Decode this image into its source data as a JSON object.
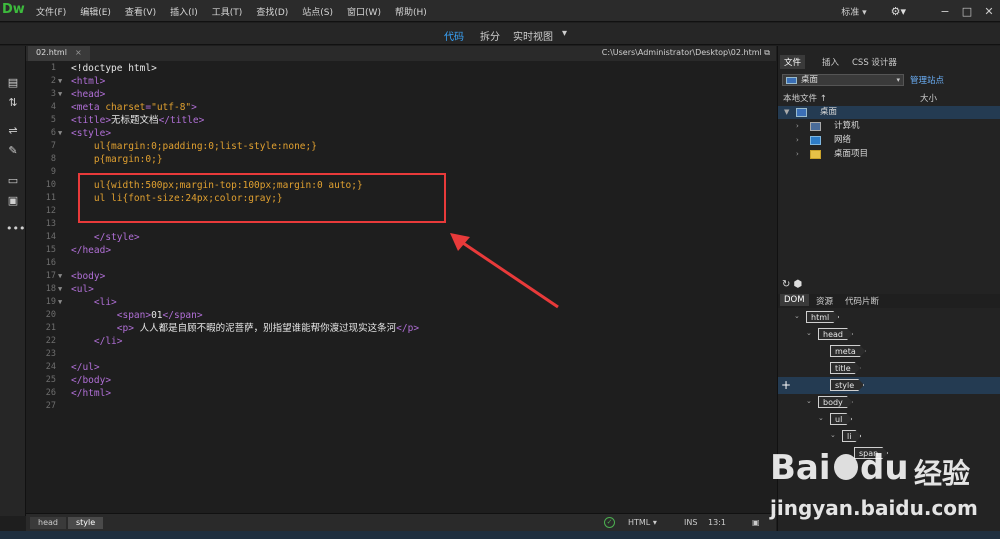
{
  "app": {
    "logo": "Dw",
    "menu": [
      "文件(F)",
      "编辑(E)",
      "查看(V)",
      "插入(I)",
      "工具(T)",
      "查找(D)",
      "站点(S)",
      "窗口(W)",
      "帮助(H)"
    ],
    "workspace": "标准",
    "window_buttons": [
      "−",
      "□",
      "✕"
    ]
  },
  "view_toolbar": {
    "code": "代码",
    "split": "拆分",
    "live": "实时视图",
    "live_arrow": "▾"
  },
  "document": {
    "tab": "02.html",
    "tab_close": "×",
    "path": "C:\\Users\\Administrator\\Desktop\\02.html"
  },
  "code_lines": [
    {
      "n": "1",
      "fold": "",
      "segs": [
        {
          "t": "<!doctype html>",
          "c": "txtc"
        }
      ]
    },
    {
      "n": "2",
      "fold": "▼",
      "segs": [
        {
          "t": "<html>",
          "c": "tag"
        }
      ]
    },
    {
      "n": "3",
      "fold": "▼",
      "segs": [
        {
          "t": "<head>",
          "c": "tag"
        }
      ]
    },
    {
      "n": "4",
      "fold": "",
      "segs": [
        {
          "t": "<meta ",
          "c": "tag"
        },
        {
          "t": "charset",
          "c": "attr"
        },
        {
          "t": "=",
          "c": "tag"
        },
        {
          "t": "\"utf-8\"",
          "c": "attr"
        },
        {
          "t": ">",
          "c": "tag"
        }
      ]
    },
    {
      "n": "5",
      "fold": "",
      "segs": [
        {
          "t": "<title>",
          "c": "tag"
        },
        {
          "t": "无标题文档",
          "c": "txtc"
        },
        {
          "t": "</title>",
          "c": "tag"
        }
      ]
    },
    {
      "n": "6",
      "fold": "▼",
      "segs": [
        {
          "t": "<style>",
          "c": "tag"
        }
      ]
    },
    {
      "n": "7",
      "fold": "",
      "segs": [
        {
          "t": "    ul{",
          "c": "sel"
        },
        {
          "t": "margin:0;padding:0;list-style:none;",
          "c": "sel"
        },
        {
          "t": "}",
          "c": "sel"
        }
      ]
    },
    {
      "n": "8",
      "fold": "",
      "segs": [
        {
          "t": "    p{",
          "c": "sel"
        },
        {
          "t": "margin:0;",
          "c": "sel"
        },
        {
          "t": "}",
          "c": "sel"
        }
      ]
    },
    {
      "n": "9",
      "fold": "",
      "segs": []
    },
    {
      "n": "10",
      "fold": "",
      "segs": [
        {
          "t": "    ul{",
          "c": "sel"
        },
        {
          "t": "width:500px;margin-top:100px;margin:0 auto;",
          "c": "sel"
        },
        {
          "t": "}",
          "c": "sel"
        }
      ]
    },
    {
      "n": "11",
      "fold": "",
      "segs": [
        {
          "t": "    ul li{",
          "c": "sel"
        },
        {
          "t": "font-size:24px;color:gray;",
          "c": "sel"
        },
        {
          "t": "}",
          "c": "sel"
        }
      ]
    },
    {
      "n": "12",
      "fold": "",
      "segs": []
    },
    {
      "n": "13",
      "fold": "",
      "segs": []
    },
    {
      "n": "14",
      "fold": "",
      "segs": [
        {
          "t": "    </style>",
          "c": "tag"
        }
      ]
    },
    {
      "n": "15",
      "fold": "",
      "segs": [
        {
          "t": "</head>",
          "c": "tag"
        }
      ]
    },
    {
      "n": "16",
      "fold": "",
      "segs": []
    },
    {
      "n": "17",
      "fold": "▼",
      "segs": [
        {
          "t": "<body>",
          "c": "tag"
        }
      ]
    },
    {
      "n": "18",
      "fold": "▼",
      "segs": [
        {
          "t": "<ul>",
          "c": "tag"
        }
      ]
    },
    {
      "n": "19",
      "fold": "▼",
      "segs": [
        {
          "t": "    <li>",
          "c": "tag"
        }
      ]
    },
    {
      "n": "20",
      "fold": "",
      "segs": [
        {
          "t": "        <span>",
          "c": "tag"
        },
        {
          "t": "01",
          "c": "txtc"
        },
        {
          "t": "</span>",
          "c": "tag"
        }
      ]
    },
    {
      "n": "21",
      "fold": "",
      "segs": [
        {
          "t": "        <p>",
          "c": "tag"
        },
        {
          "t": " 人人都是自顾不暇的泥菩萨，别指望谁能帮你渡过现实这条河",
          "c": "txtc"
        },
        {
          "t": "</p>",
          "c": "tag"
        }
      ]
    },
    {
      "n": "22",
      "fold": "",
      "segs": [
        {
          "t": "    </li>",
          "c": "tag"
        }
      ]
    },
    {
      "n": "23",
      "fold": "",
      "segs": []
    },
    {
      "n": "24",
      "fold": "",
      "segs": [
        {
          "t": "</ul>",
          "c": "tag"
        }
      ]
    },
    {
      "n": "25",
      "fold": "",
      "segs": [
        {
          "t": "</body>",
          "c": "tag"
        }
      ]
    },
    {
      "n": "26",
      "fold": "",
      "segs": [
        {
          "t": "</html>",
          "c": "tag"
        }
      ]
    },
    {
      "n": "27",
      "fold": "",
      "segs": []
    }
  ],
  "status": {
    "crumbs": [
      "head",
      "style"
    ],
    "ok_mark": "✓",
    "doc_type": "HTML",
    "doc_type_arrow": "▾",
    "ins": "INS",
    "position": "13:1"
  },
  "files_panel": {
    "tabs": [
      "文件",
      "插入",
      "CSS 设计器"
    ],
    "site": "桌面",
    "site_arrow": "▾",
    "manage": "管理站点",
    "col_local": "本地文件 ↑",
    "col_size": "大小",
    "tree": [
      {
        "label": "桌面",
        "chev": "▼"
      },
      {
        "label": "计算机",
        "chev": "›"
      },
      {
        "label": "网络",
        "chev": "›"
      },
      {
        "label": "桌面项目",
        "chev": "›"
      }
    ]
  },
  "dom_panel": {
    "tools": "↻  ⬢",
    "tabs": [
      "DOM",
      "资源",
      "代码片断"
    ],
    "nodes": [
      "html",
      "head",
      "meta",
      "title",
      "style",
      "body",
      "ul",
      "li",
      "span"
    ]
  },
  "watermark": {
    "brand": "Bai",
    "brand2": "du",
    "cn": "经验",
    "url": "jingyan.baidu.com"
  },
  "colors": {
    "accent": "#3aa7ff",
    "highlight_box": "#e83a3a",
    "selected_row": "#243b52"
  }
}
